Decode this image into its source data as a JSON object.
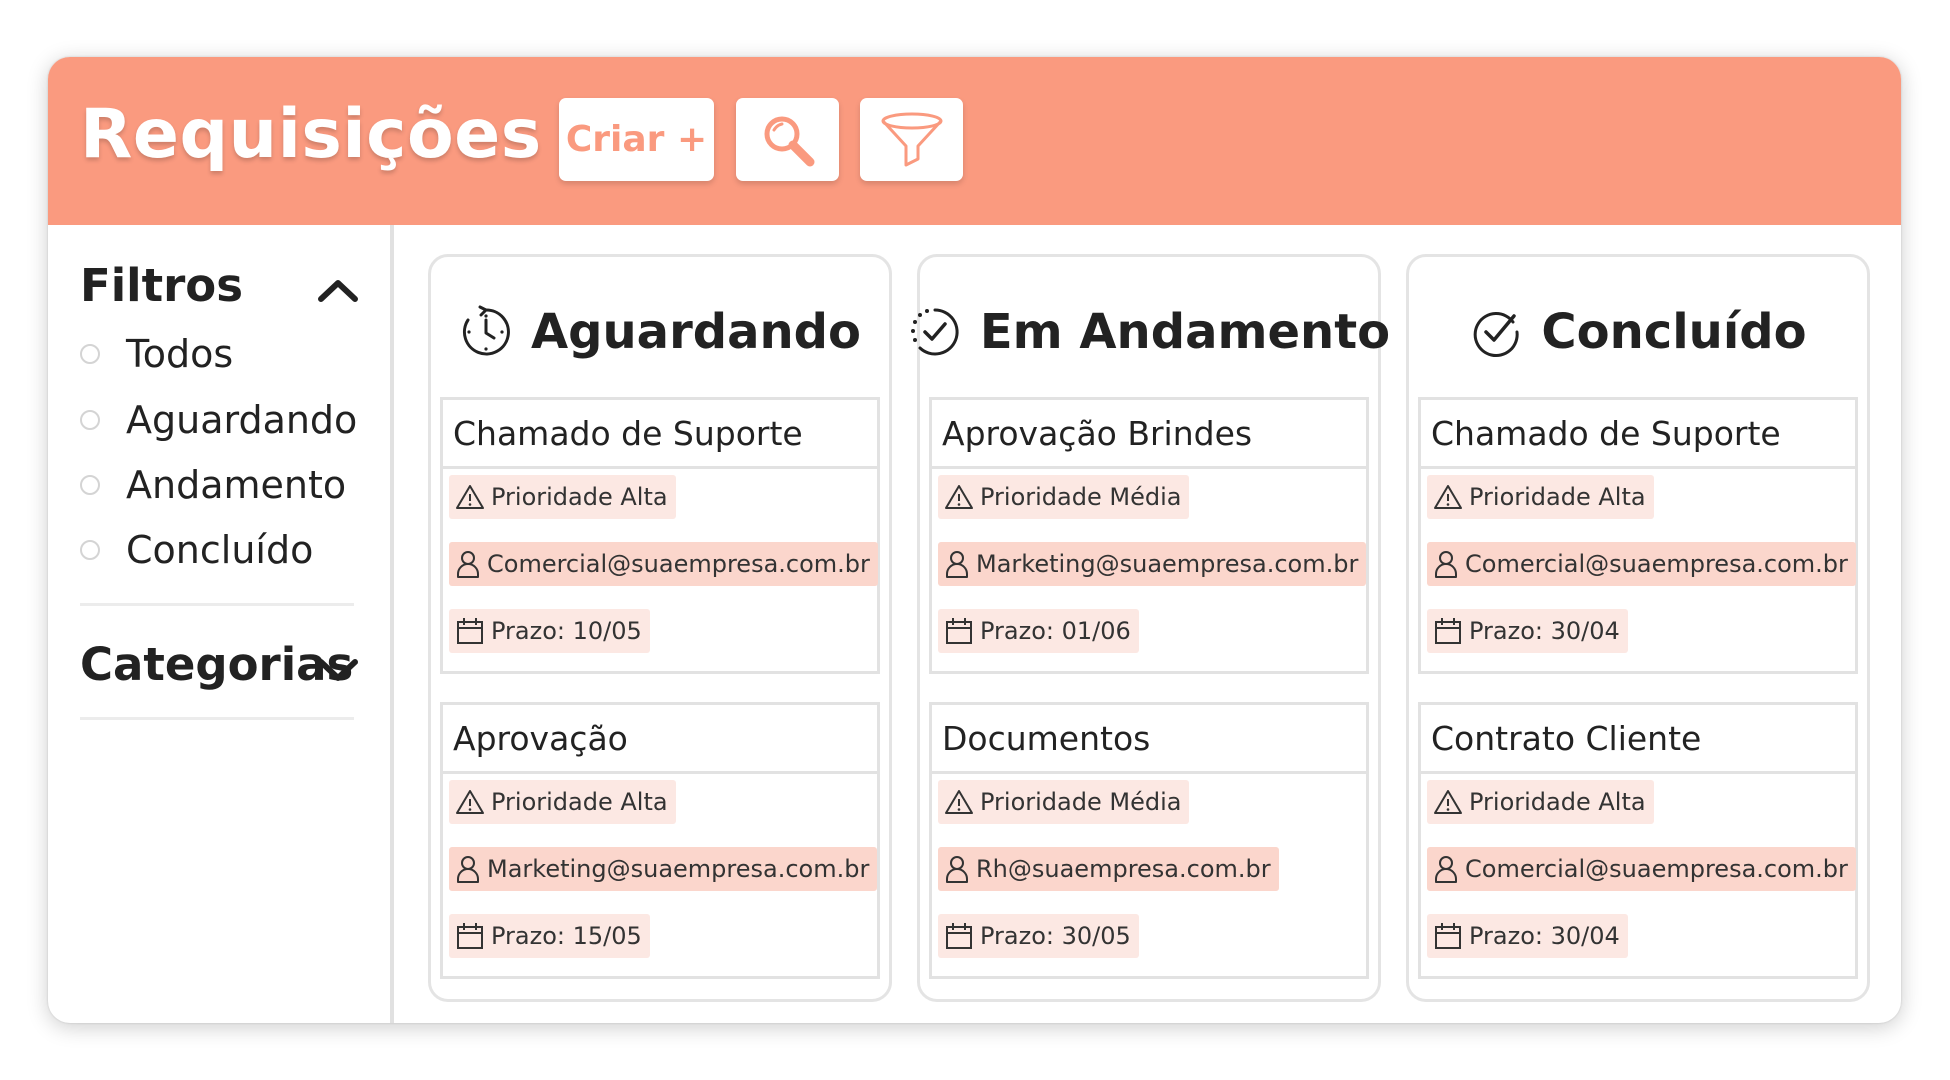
{
  "header": {
    "title": "Requisições",
    "create_label": "Criar +",
    "accent_color": "#fa9a7f"
  },
  "sidebar": {
    "filters_title": "Filtros",
    "options": [
      "Todos",
      "Aguardando",
      "Andamento",
      "Concluído"
    ],
    "categories_title": "Categorias"
  },
  "columns": [
    {
      "title": "Aguardando",
      "icon": "clock-icon",
      "cards": [
        {
          "title": "Chamado de Suporte",
          "priority": "Prioridade Alta",
          "email": "Comercial@suaempresa.com.br",
          "deadline": "Prazo: 10/05"
        },
        {
          "title": "Aprovação",
          "priority": "Prioridade Alta",
          "email": "Marketing@suaempresa.com.br",
          "deadline": "Prazo: 15/05"
        }
      ]
    },
    {
      "title": "Em Andamento",
      "icon": "progress-check-icon",
      "cards": [
        {
          "title": "Aprovação Brindes",
          "priority": "Prioridade Média",
          "email": "Marketing@suaempresa.com.br",
          "deadline": "Prazo: 01/06"
        },
        {
          "title": "Documentos",
          "priority": "Prioridade Média",
          "email": "Rh@suaempresa.com.br",
          "deadline": "Prazo: 30/05"
        }
      ]
    },
    {
      "title": "Concluído",
      "icon": "check-circle-icon",
      "cards": [
        {
          "title": "Chamado de Suporte",
          "priority": "Prioridade Alta",
          "email": "Comercial@suaempresa.com.br",
          "deadline": "Prazo: 30/04"
        },
        {
          "title": "Contrato Cliente",
          "priority": "Prioridade Alta",
          "email": "Comercial@suaempresa.com.br",
          "deadline": "Prazo: 30/04"
        }
      ]
    }
  ]
}
